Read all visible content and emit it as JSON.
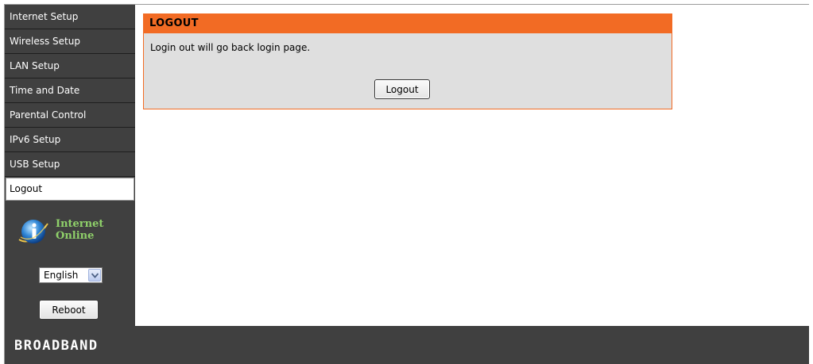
{
  "sidebar": {
    "items": [
      {
        "label": "Internet Setup"
      },
      {
        "label": "Wireless Setup"
      },
      {
        "label": "LAN Setup"
      },
      {
        "label": "Time and Date"
      },
      {
        "label": "Parental Control"
      },
      {
        "label": "IPv6 Setup"
      },
      {
        "label": "USB Setup"
      },
      {
        "label": "Logout",
        "active": true
      }
    ],
    "status": {
      "icon": "info-icon",
      "line1": "Internet",
      "line2": "Online",
      "color": "#8fd06a"
    },
    "language": {
      "selected": "English"
    },
    "reboot_label": "Reboot"
  },
  "panel": {
    "title": "LOGOUT",
    "message": "Login out will go back login page.",
    "button_label": "Logout",
    "accent_color": "#f26b24"
  },
  "footer": {
    "brand": "BROADBAND"
  }
}
